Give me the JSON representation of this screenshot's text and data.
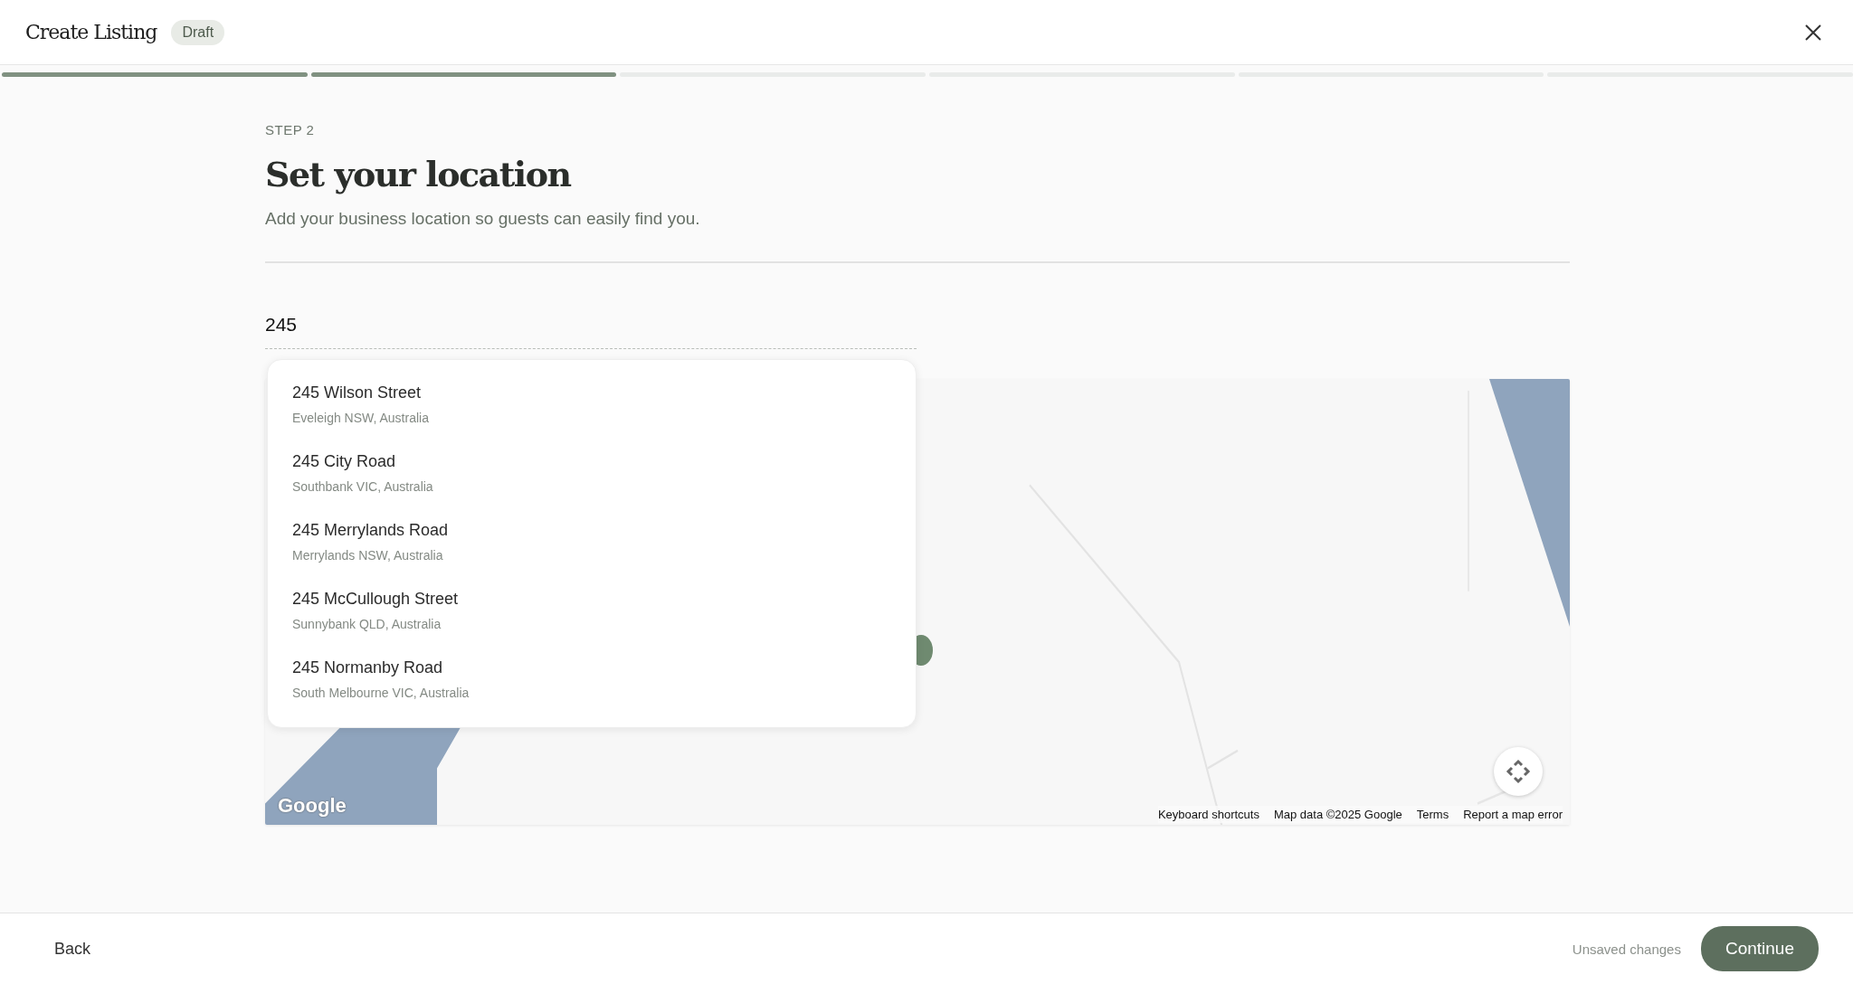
{
  "header": {
    "title": "Create Listing",
    "badge": "Draft"
  },
  "progress": [
    {
      "done": true
    },
    {
      "done": true
    },
    {
      "done": false
    },
    {
      "done": false
    },
    {
      "done": false
    },
    {
      "done": false
    }
  ],
  "step_label": "STEP 2",
  "heading": "Set your location",
  "subtitle": "Add your business location so guests can easily find you.",
  "search": {
    "value": "245"
  },
  "suggestions": [
    {
      "street": "245 Wilson Street",
      "area": "Eveleigh NSW, Australia"
    },
    {
      "street": "245 City Road",
      "area": "Southbank VIC, Australia"
    },
    {
      "street": "245 Merrylands Road",
      "area": "Merrylands NSW, Australia"
    },
    {
      "street": "245 McCullough Street",
      "area": "Sunnybank QLD, Australia"
    },
    {
      "street": "245 Normanby Road",
      "area": "South Melbourne VIC, Australia"
    }
  ],
  "map": {
    "logo": "Google",
    "footer_links": [
      "Keyboard shortcuts",
      "Map data ©2025 Google",
      "Terms",
      "Report a map error"
    ]
  },
  "footer": {
    "back": "Back",
    "status": "Unsaved changes",
    "continue": "Continue"
  }
}
